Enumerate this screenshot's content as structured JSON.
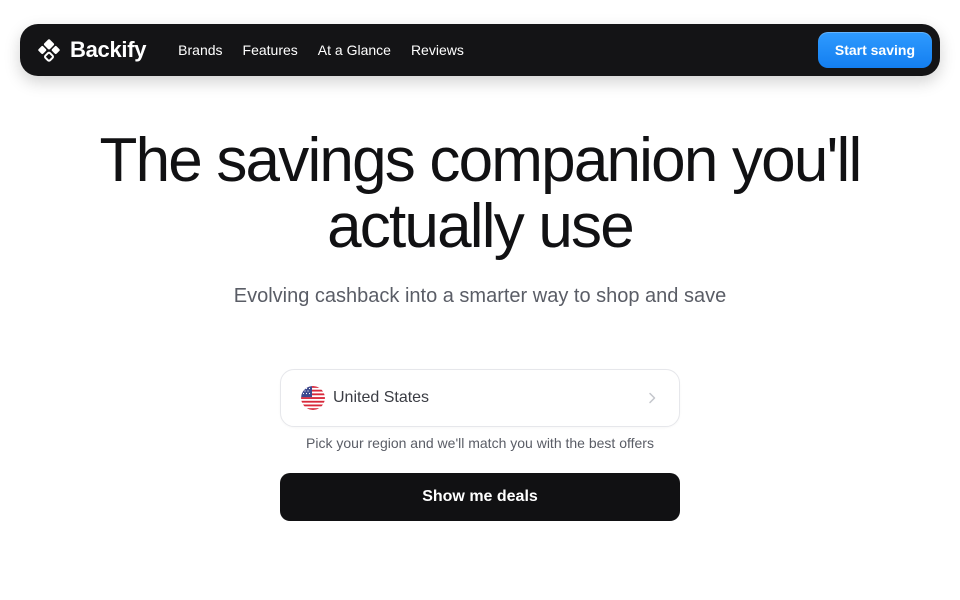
{
  "brand": {
    "name": "Backify",
    "logo_icon": "backify-logo-icon"
  },
  "nav": {
    "links": [
      {
        "label": "Brands"
      },
      {
        "label": "Features"
      },
      {
        "label": "At a Glance"
      },
      {
        "label": "Reviews"
      }
    ],
    "cta_label": "Start saving"
  },
  "hero": {
    "title_line1": "The savings companion you'll",
    "title_line2": "actually use",
    "subtitle": "Evolving cashback into a smarter way to shop and save"
  },
  "region": {
    "selected": "United States",
    "flag_icon": "us-flag-icon",
    "helper_text": "Pick your region and we'll match you with the best offers"
  },
  "actions": {
    "primary_label": "Show me deals"
  },
  "colors": {
    "navbar_bg": "#141416",
    "accent": "#1d87f5",
    "primary_button": "#111113",
    "text_muted": "#5a5d66"
  }
}
